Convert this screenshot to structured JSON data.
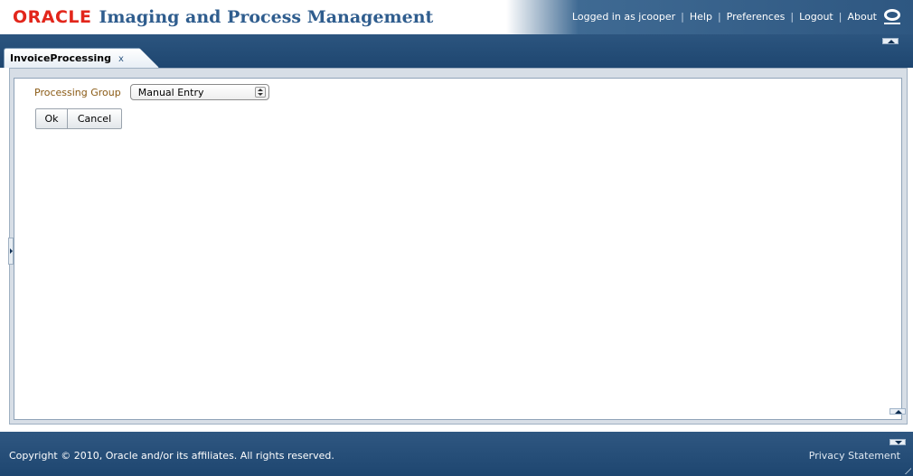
{
  "header": {
    "logo_text": "ORACLE",
    "app_title": "Imaging and Process Management",
    "user_text": "Logged in as jcooper",
    "links": [
      "Help",
      "Preferences",
      "Logout",
      "About"
    ],
    "oracle_icon": "oracle-o-icon"
  },
  "tabs": [
    {
      "label": "InvoiceProcessing",
      "close": "x"
    }
  ],
  "form": {
    "processing_group_label": "Processing Group",
    "processing_group_value": "Manual Entry"
  },
  "buttons": {
    "ok": "Ok",
    "cancel": "Cancel"
  },
  "footer": {
    "copyright": "Copyright © 2010, Oracle and/or its affiliates. All rights reserved.",
    "privacy": "Privacy Statement"
  },
  "colors": {
    "oracle_red": "#e2261b",
    "title_blue": "#2f5d8e",
    "band_blue": "#1e4670",
    "label_brown": "#8a5a14"
  }
}
